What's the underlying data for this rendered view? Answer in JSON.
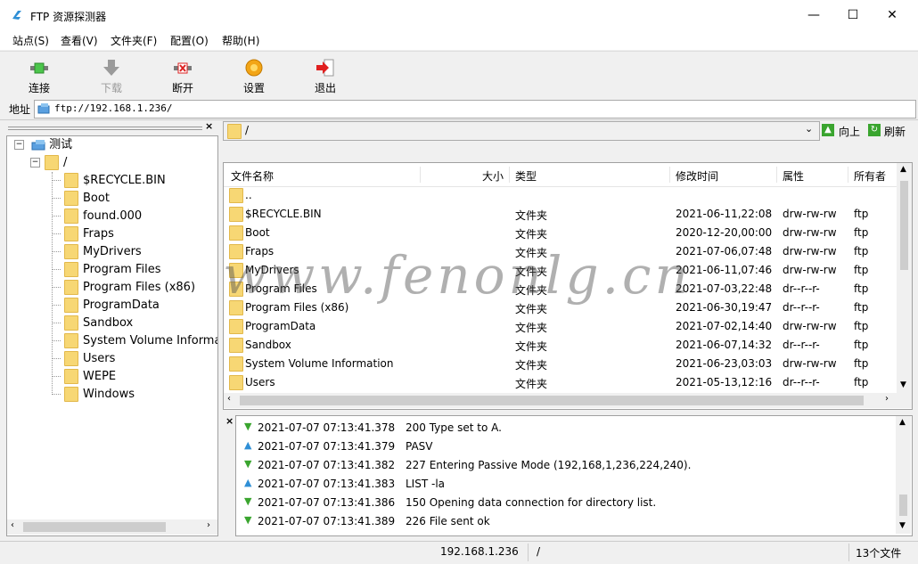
{
  "window": {
    "title": "FTP 资源探测器",
    "minimize": "—",
    "maximize": "☐",
    "close": "✕"
  },
  "menu": [
    "站点(S)",
    "查看(V)",
    "文件夹(F)",
    "配置(O)",
    "帮助(H)"
  ],
  "toolbar": {
    "connect": "连接",
    "download": "下载",
    "disconnect": "断开",
    "settings": "设置",
    "exit": "退出"
  },
  "address": {
    "label": "地址",
    "value": "ftp://192.168.1.236/"
  },
  "tree": {
    "root": "测试",
    "path": "/",
    "items": [
      "$RECYCLE.BIN",
      "Boot",
      "found.000",
      "Fraps",
      "MyDrivers",
      "Program Files",
      "Program Files (x86)",
      "ProgramData",
      "Sandbox",
      "System Volume Informatic",
      "Users",
      "WEPE",
      "Windows"
    ]
  },
  "pathbar": {
    "path": "/",
    "up": "向上",
    "refresh": "刷新"
  },
  "list": {
    "headers": {
      "name": "文件名称",
      "size": "大小",
      "type": "类型",
      "mtime": "修改时间",
      "attr": "属性",
      "owner": "所有者"
    },
    "parent": "..",
    "rows": [
      {
        "name": "$RECYCLE.BIN",
        "type": "文件夹",
        "mtime": "2021-06-11,22:08",
        "attr": "drw-rw-rw",
        "owner": "ftp"
      },
      {
        "name": "Boot",
        "type": "文件夹",
        "mtime": "2020-12-20,00:00",
        "attr": "drw-rw-rw",
        "owner": "ftp"
      },
      {
        "name": "Fraps",
        "type": "文件夹",
        "mtime": "2021-07-06,07:48",
        "attr": "drw-rw-rw",
        "owner": "ftp"
      },
      {
        "name": "MyDrivers",
        "type": "文件夹",
        "mtime": "2021-06-11,07:46",
        "attr": "drw-rw-rw",
        "owner": "ftp"
      },
      {
        "name": "Program Files",
        "type": "文件夹",
        "mtime": "2021-07-03,22:48",
        "attr": "dr--r--r-",
        "owner": "ftp"
      },
      {
        "name": "Program Files (x86)",
        "type": "文件夹",
        "mtime": "2021-06-30,19:47",
        "attr": "dr--r--r-",
        "owner": "ftp"
      },
      {
        "name": "ProgramData",
        "type": "文件夹",
        "mtime": "2021-07-02,14:40",
        "attr": "drw-rw-rw",
        "owner": "ftp"
      },
      {
        "name": "Sandbox",
        "type": "文件夹",
        "mtime": "2021-06-07,14:32",
        "attr": "dr--r--r-",
        "owner": "ftp"
      },
      {
        "name": "System Volume Information",
        "type": "文件夹",
        "mtime": "2021-06-23,03:03",
        "attr": "drw-rw-rw",
        "owner": "ftp"
      },
      {
        "name": "Users",
        "type": "文件夹",
        "mtime": "2021-05-13,12:16",
        "attr": "dr--r--r-",
        "owner": "ftp"
      }
    ]
  },
  "log": [
    {
      "dir": "down",
      "time": "2021-07-07 07:13:41.378",
      "msg": "200 Type set to A."
    },
    {
      "dir": "up",
      "time": "2021-07-07 07:13:41.379",
      "msg": "PASV"
    },
    {
      "dir": "down",
      "time": "2021-07-07 07:13:41.382",
      "msg": "227 Entering Passive Mode (192,168,1,236,224,240)."
    },
    {
      "dir": "up",
      "time": "2021-07-07 07:13:41.383",
      "msg": "LIST -la"
    },
    {
      "dir": "down",
      "time": "2021-07-07 07:13:41.386",
      "msg": "150 Opening data connection for directory list."
    },
    {
      "dir": "down",
      "time": "2021-07-07 07:13:41.389",
      "msg": "226 File sent ok"
    }
  ],
  "status": {
    "host": "192.168.1.236",
    "path": "/",
    "count": "13个文件"
  },
  "watermark": "www.fenonlg.cn",
  "colors": {
    "arrow_down": "#3aa52f",
    "arrow_up": "#2f8fd6",
    "folder": "#f7d774"
  }
}
